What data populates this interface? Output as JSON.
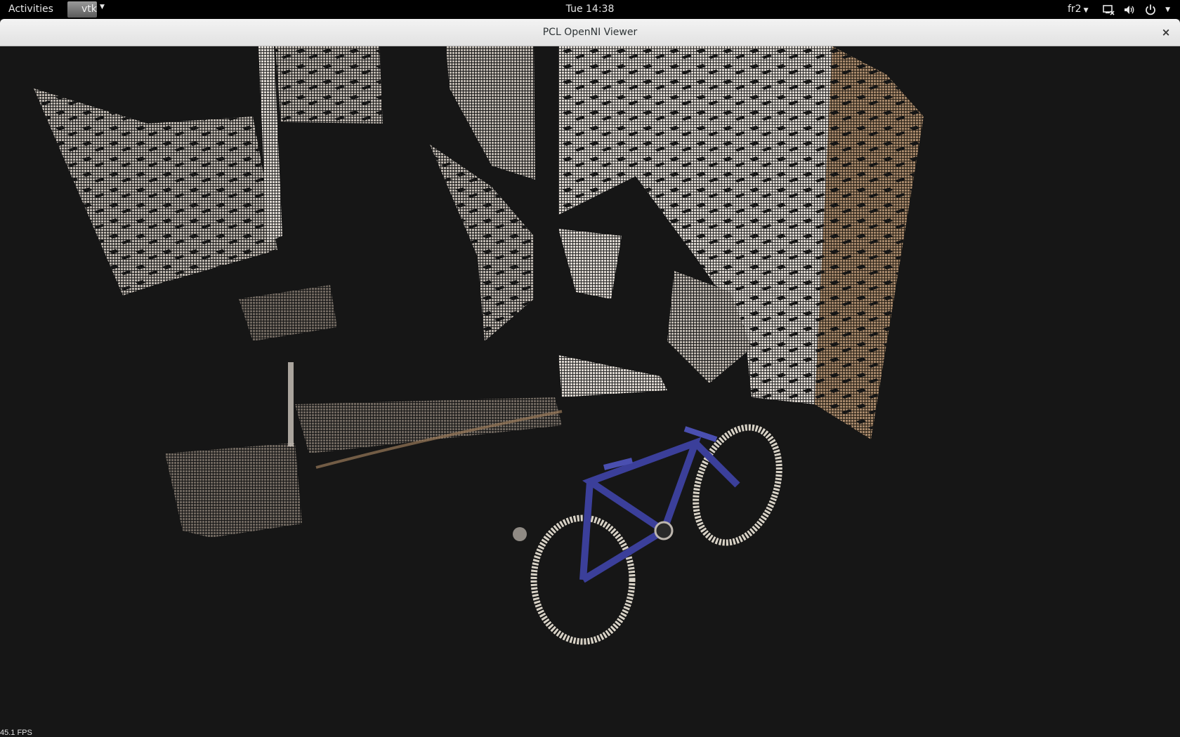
{
  "topbar": {
    "activities_label": "Activities",
    "app_menu_label": "vtk",
    "clock": "Tue 14:38",
    "keyboard_layout": "fr2",
    "tray_icons": [
      "network-icon",
      "volume-icon",
      "power-icon"
    ]
  },
  "window": {
    "title": "PCL OpenNI Viewer",
    "close_glyph": "×"
  },
  "viewer": {
    "fps_label": "45.1 FPS",
    "background_color": "#161616",
    "scene_objects": [
      "wall-panel",
      "door",
      "cabinet",
      "right-wall",
      "shadowed-box",
      "bicycle"
    ]
  }
}
